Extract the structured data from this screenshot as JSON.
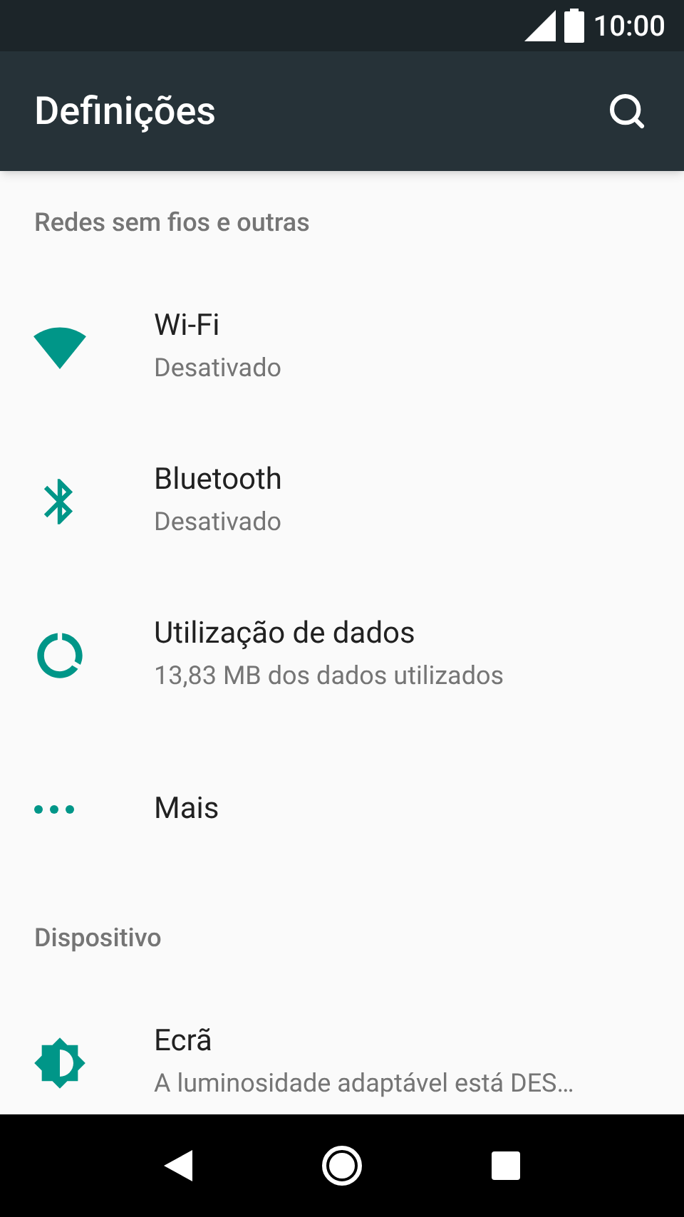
{
  "status_bar": {
    "time": "10:00"
  },
  "app_bar": {
    "title": "Definições"
  },
  "sections": [
    {
      "header": "Redes sem fios e outras",
      "items": [
        {
          "title": "Wi-Fi",
          "subtitle": "Desativado"
        },
        {
          "title": "Bluetooth",
          "subtitle": "Desativado"
        },
        {
          "title": "Utilização de dados",
          "subtitle": "13,83 MB dos dados utilizados"
        },
        {
          "title": "Mais"
        }
      ]
    },
    {
      "header": "Dispositivo",
      "items": [
        {
          "title": "Ecrã",
          "subtitle": "A luminosidade adaptável está DES…"
        }
      ]
    }
  ]
}
